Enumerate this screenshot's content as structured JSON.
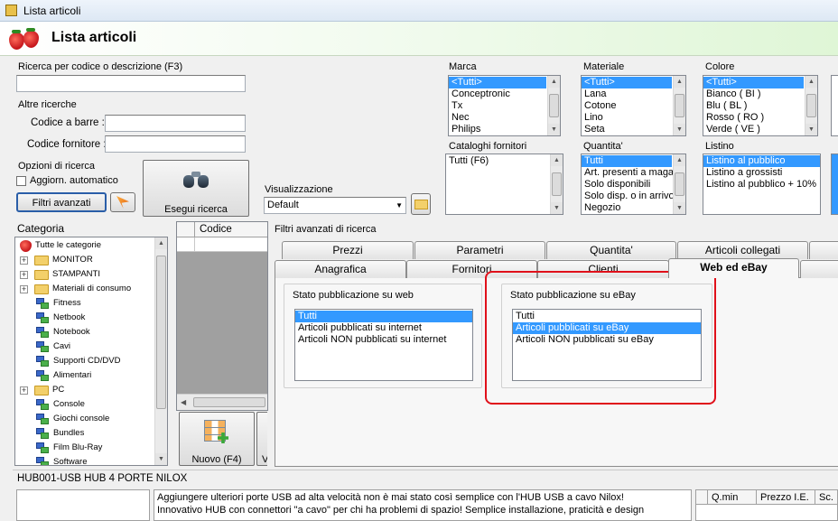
{
  "window": {
    "title": "Lista articoli"
  },
  "header": {
    "title": "Lista articoli"
  },
  "search": {
    "label": "Ricerca per codice o descrizione (F3)",
    "value": "",
    "other_label": "Altre ricerche",
    "barcode_label": "Codice a barre :",
    "supplier_code_label": "Codice fornitore :"
  },
  "options": {
    "label": "Opzioni di ricerca",
    "auto_update": "Aggiorn. automatico",
    "advanced_filters": "Filtri avanzati",
    "run_search": "Esegui ricerca"
  },
  "display": {
    "label": "Visualizzazione",
    "value": "Default"
  },
  "filters": {
    "marca": {
      "label": "Marca",
      "items": [
        "<Tutti>",
        "Conceptronic",
        "Tx",
        "Nec",
        "Philips"
      ],
      "selected": 0
    },
    "materiale": {
      "label": "Materiale",
      "items": [
        "<Tutti>",
        "Lana",
        "Cotone",
        "Lino",
        "Seta"
      ],
      "selected": 0
    },
    "colore": {
      "label": "Colore",
      "items": [
        "<Tutti>",
        "Bianco ( BI )",
        "Blu ( BL )",
        "Rosso ( RO )",
        "Verde ( VE )"
      ],
      "selected": 0
    },
    "cataloghi": {
      "label": "Cataloghi fornitori",
      "items": [
        "Tutti (F6)"
      ],
      "selected": -1
    },
    "quantita": {
      "label": "Quantita'",
      "items": [
        "Tutti",
        "Art. presenti a magazzino",
        "Solo disponibili",
        "Solo disp. o in arrivo",
        "Negozio"
      ],
      "selected": 0
    },
    "listino": {
      "label": "Listino",
      "items": [
        "Listino al pubblico",
        "Listino a grossisti",
        "Listino al pubblico + 10%"
      ],
      "selected": 0
    }
  },
  "category": {
    "label": "Categoria",
    "items": [
      {
        "label": "Tutte le categorie",
        "type": "root"
      },
      {
        "label": "MONITOR",
        "type": "folder"
      },
      {
        "label": "STAMPANTI",
        "type": "folder"
      },
      {
        "label": "Materiali di consumo",
        "type": "folder"
      },
      {
        "label": "Fitness",
        "type": "net"
      },
      {
        "label": "Netbook",
        "type": "net"
      },
      {
        "label": "Notebook",
        "type": "net"
      },
      {
        "label": "Cavi",
        "type": "net"
      },
      {
        "label": "Supporti CD/DVD",
        "type": "net"
      },
      {
        "label": "Alimentari",
        "type": "net"
      },
      {
        "label": "PC",
        "type": "folder"
      },
      {
        "label": "Console",
        "type": "net"
      },
      {
        "label": "Giochi console",
        "type": "net"
      },
      {
        "label": "Bundles",
        "type": "net"
      },
      {
        "label": "Film Blu-Ray",
        "type": "net"
      },
      {
        "label": "Software",
        "type": "net"
      }
    ]
  },
  "grid": {
    "col_code": "Codice"
  },
  "new_button": {
    "label": "Nuovo (F4)",
    "partial": "V"
  },
  "advanced": {
    "title": "Filtri avanzati di ricerca",
    "tabs_row1": [
      "Prezzi",
      "Parametri",
      "Quantita'",
      "Articoli collegati"
    ],
    "tabs_row2": [
      "Anagrafica",
      "Fornitori",
      "Clienti",
      "Web ed eBay"
    ],
    "active_tab": "Web ed eBay",
    "web": {
      "label": "Stato pubblicazione su web",
      "items": [
        "Tutti",
        "Articoli pubblicati su internet",
        "Articoli NON pubblicati su internet"
      ],
      "selected": 0
    },
    "ebay": {
      "label": "Stato pubblicazione su eBay",
      "items": [
        "Tutti",
        "Articoli pubblicati su eBay",
        "Articoli NON pubblicati su eBay"
      ],
      "selected": 1
    }
  },
  "detail": {
    "title": "HUB001-USB HUB 4 PORTE NILOX",
    "description_line1": "Aggiungere ulteriori porte USB ad alta velocità non è mai stato così semplice con l'HUB USB a cavo Nilox!",
    "description_line2": "Innovativo HUB con connettori \"a cavo\" per chi ha problemi di spazio! Semplice installazione, praticità e design",
    "price_cols": [
      "Q.min",
      "Prezzo I.E.",
      "Sc."
    ]
  },
  "colors": {
    "accent": "#e0101a",
    "selection": "#3399ff"
  }
}
